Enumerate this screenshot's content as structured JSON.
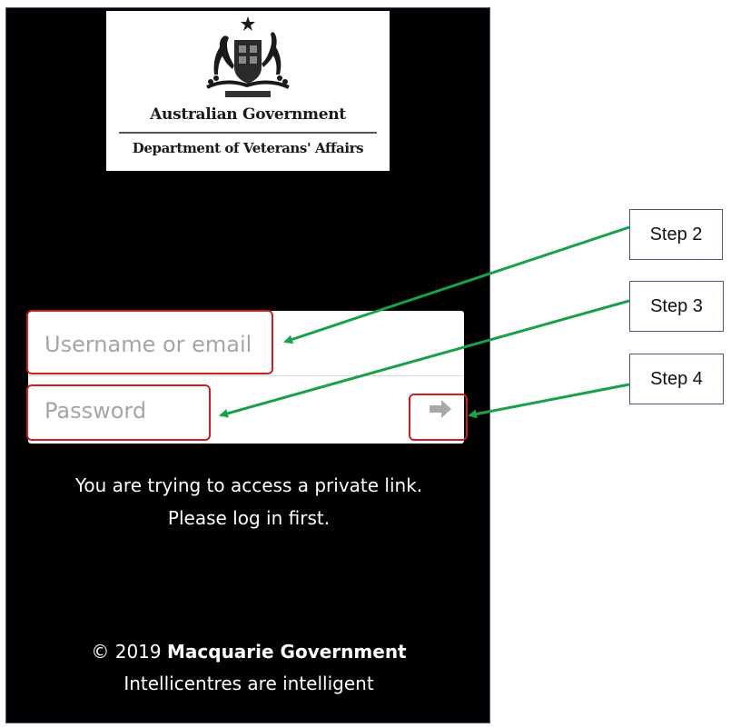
{
  "logo": {
    "line1": "Australian Government",
    "line2": "Department of Veterans' Affairs",
    "emblem": "coat-of-arms-emblem"
  },
  "login": {
    "username_placeholder": "Username or email",
    "password_placeholder": "Password",
    "submit_icon": "arrow-right-icon"
  },
  "message": {
    "line1": "You are trying to access a private link.",
    "line2": "Please log in first."
  },
  "footer": {
    "copyright_prefix": "© 2019 ",
    "company": "Macquarie Government",
    "tagline": "Intellicentres are intelligent"
  },
  "annotations": {
    "step2": "Step 2",
    "step3": "Step 3",
    "step4": "Step 4"
  },
  "colors": {
    "panel_bg": "#000000",
    "highlight_border": "#cc1f1f",
    "annotation_arrow": "#1aa04a"
  }
}
